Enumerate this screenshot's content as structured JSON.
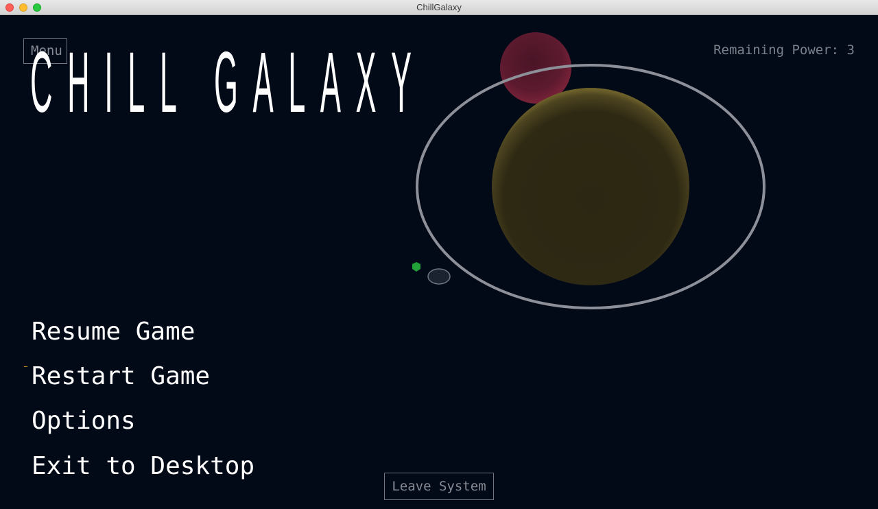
{
  "window": {
    "title": "ChillGalaxy"
  },
  "hud": {
    "menu_label": "Menu",
    "remaining_power": "Remaining Power: 3",
    "leave_label": "Leave System"
  },
  "game_title": "CHILL GALAXY",
  "main_menu": {
    "items": [
      {
        "label": "Resume Game"
      },
      {
        "label": "Restart Game"
      },
      {
        "label": "Options"
      },
      {
        "label": "Exit to Desktop"
      }
    ]
  },
  "colors": {
    "background": "#030a17",
    "star": "#2e2914",
    "star_rim": "#6b5f2a",
    "orbit_ring": "#8d9099",
    "red_planet": "#6b1a2e",
    "player_ship": "#22a13a"
  }
}
